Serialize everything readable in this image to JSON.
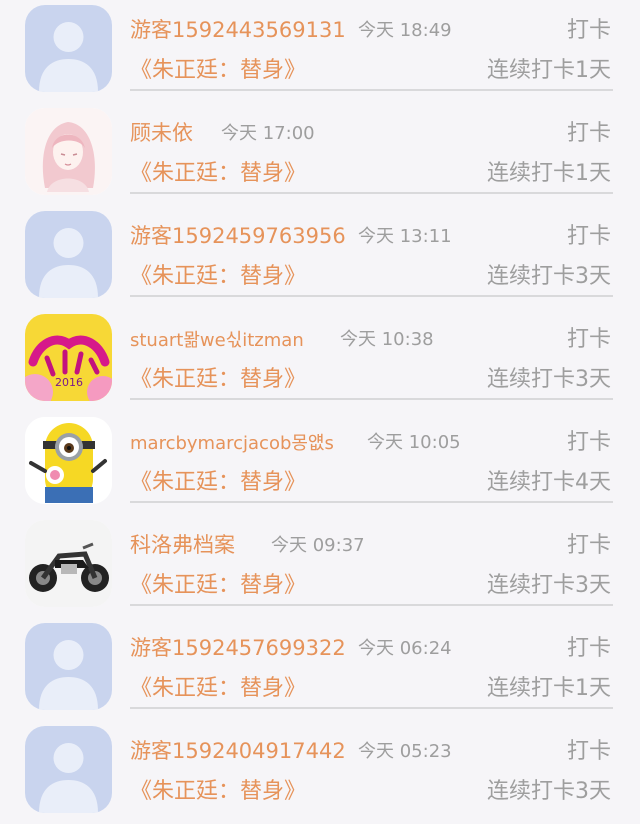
{
  "checkins": [
    {
      "name": "游客1592443569131",
      "time": "今天 18:49",
      "action": "打卡",
      "book": "《朱正廷：替身》",
      "streak": "连续打卡1天",
      "avatar": "default-avatar-icon"
    },
    {
      "name": "顾未依",
      "time": "今天 17:00",
      "action": "打卡",
      "book": "《朱正廷：替身》",
      "streak": "连续打卡1天",
      "avatar": "anime-girl-avatar"
    },
    {
      "name": "游客1592459763956",
      "time": "今天 13:11",
      "action": "打卡",
      "book": "《朱正廷：替身》",
      "streak": "连续打卡3天",
      "avatar": "default-avatar-icon"
    },
    {
      "name": "stuart뫎we싟itzman",
      "time": "今天 10:38",
      "action": "打卡",
      "book": "《朱正廷：替身》",
      "streak": "连续打卡3天",
      "avatar": "valentines-day-avatar"
    },
    {
      "name": "marcbymarcjacob몽얪s",
      "time": "今天 10:05",
      "action": "打卡",
      "book": "《朱正廷：替身》",
      "streak": "连续打卡4天",
      "avatar": "minion-avatar"
    },
    {
      "name": "科洛弗档案",
      "time": "今天 09:37",
      "action": "打卡",
      "book": "《朱正廷：替身》",
      "streak": "连续打卡3天",
      "avatar": "motorcycle-avatar"
    },
    {
      "name": "游客1592457699322",
      "time": "今天 06:24",
      "action": "打卡",
      "book": "《朱正廷：替身》",
      "streak": "连续打卡1天",
      "avatar": "default-avatar-icon"
    },
    {
      "name": "游客1592404917442",
      "time": "今天 05:23",
      "action": "打卡",
      "book": "《朱正廷：替身》",
      "streak": "连续打卡3天",
      "avatar": "default-avatar-icon"
    }
  ],
  "colors": {
    "accent": "#e6935a",
    "muted": "#9e9e9e",
    "background": "#f6f5f8",
    "avatar_default": "#c9d4ee"
  }
}
